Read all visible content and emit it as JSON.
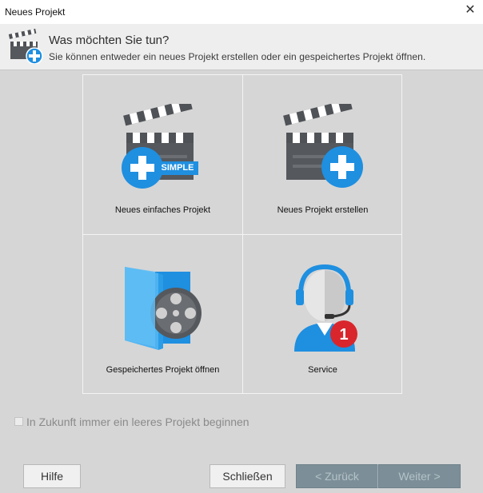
{
  "window": {
    "title": "Neues Projekt"
  },
  "header": {
    "heading": "Was möchten Sie tun?",
    "subheading": "Sie können entweder ein neues Projekt erstellen oder ein gespeichertes Projekt öffnen."
  },
  "tiles": [
    {
      "label": "Neues einfaches Projekt",
      "icon": "clapperboard-plus-simple-icon",
      "badge_text": "SIMPLE"
    },
    {
      "label": "Neues Projekt erstellen",
      "icon": "clapperboard-plus-icon"
    },
    {
      "label": "Gespeichertes Projekt öffnen",
      "icon": "film-reel-folder-icon"
    },
    {
      "label": "Service",
      "icon": "support-headset-icon",
      "notification_count": "1"
    }
  ],
  "checkbox": {
    "label": "In Zukunft immer ein leeres Projekt beginnen",
    "checked": false
  },
  "buttons": {
    "help": "Hilfe",
    "close": "Schließen",
    "back": "< Zurück",
    "next": "Weiter >"
  },
  "colors": {
    "accent_blue": "#1f8fe0",
    "clapper_dark": "#55585c",
    "notification_red": "#d9262c",
    "nav_button_disabled": "#7c8f98"
  }
}
